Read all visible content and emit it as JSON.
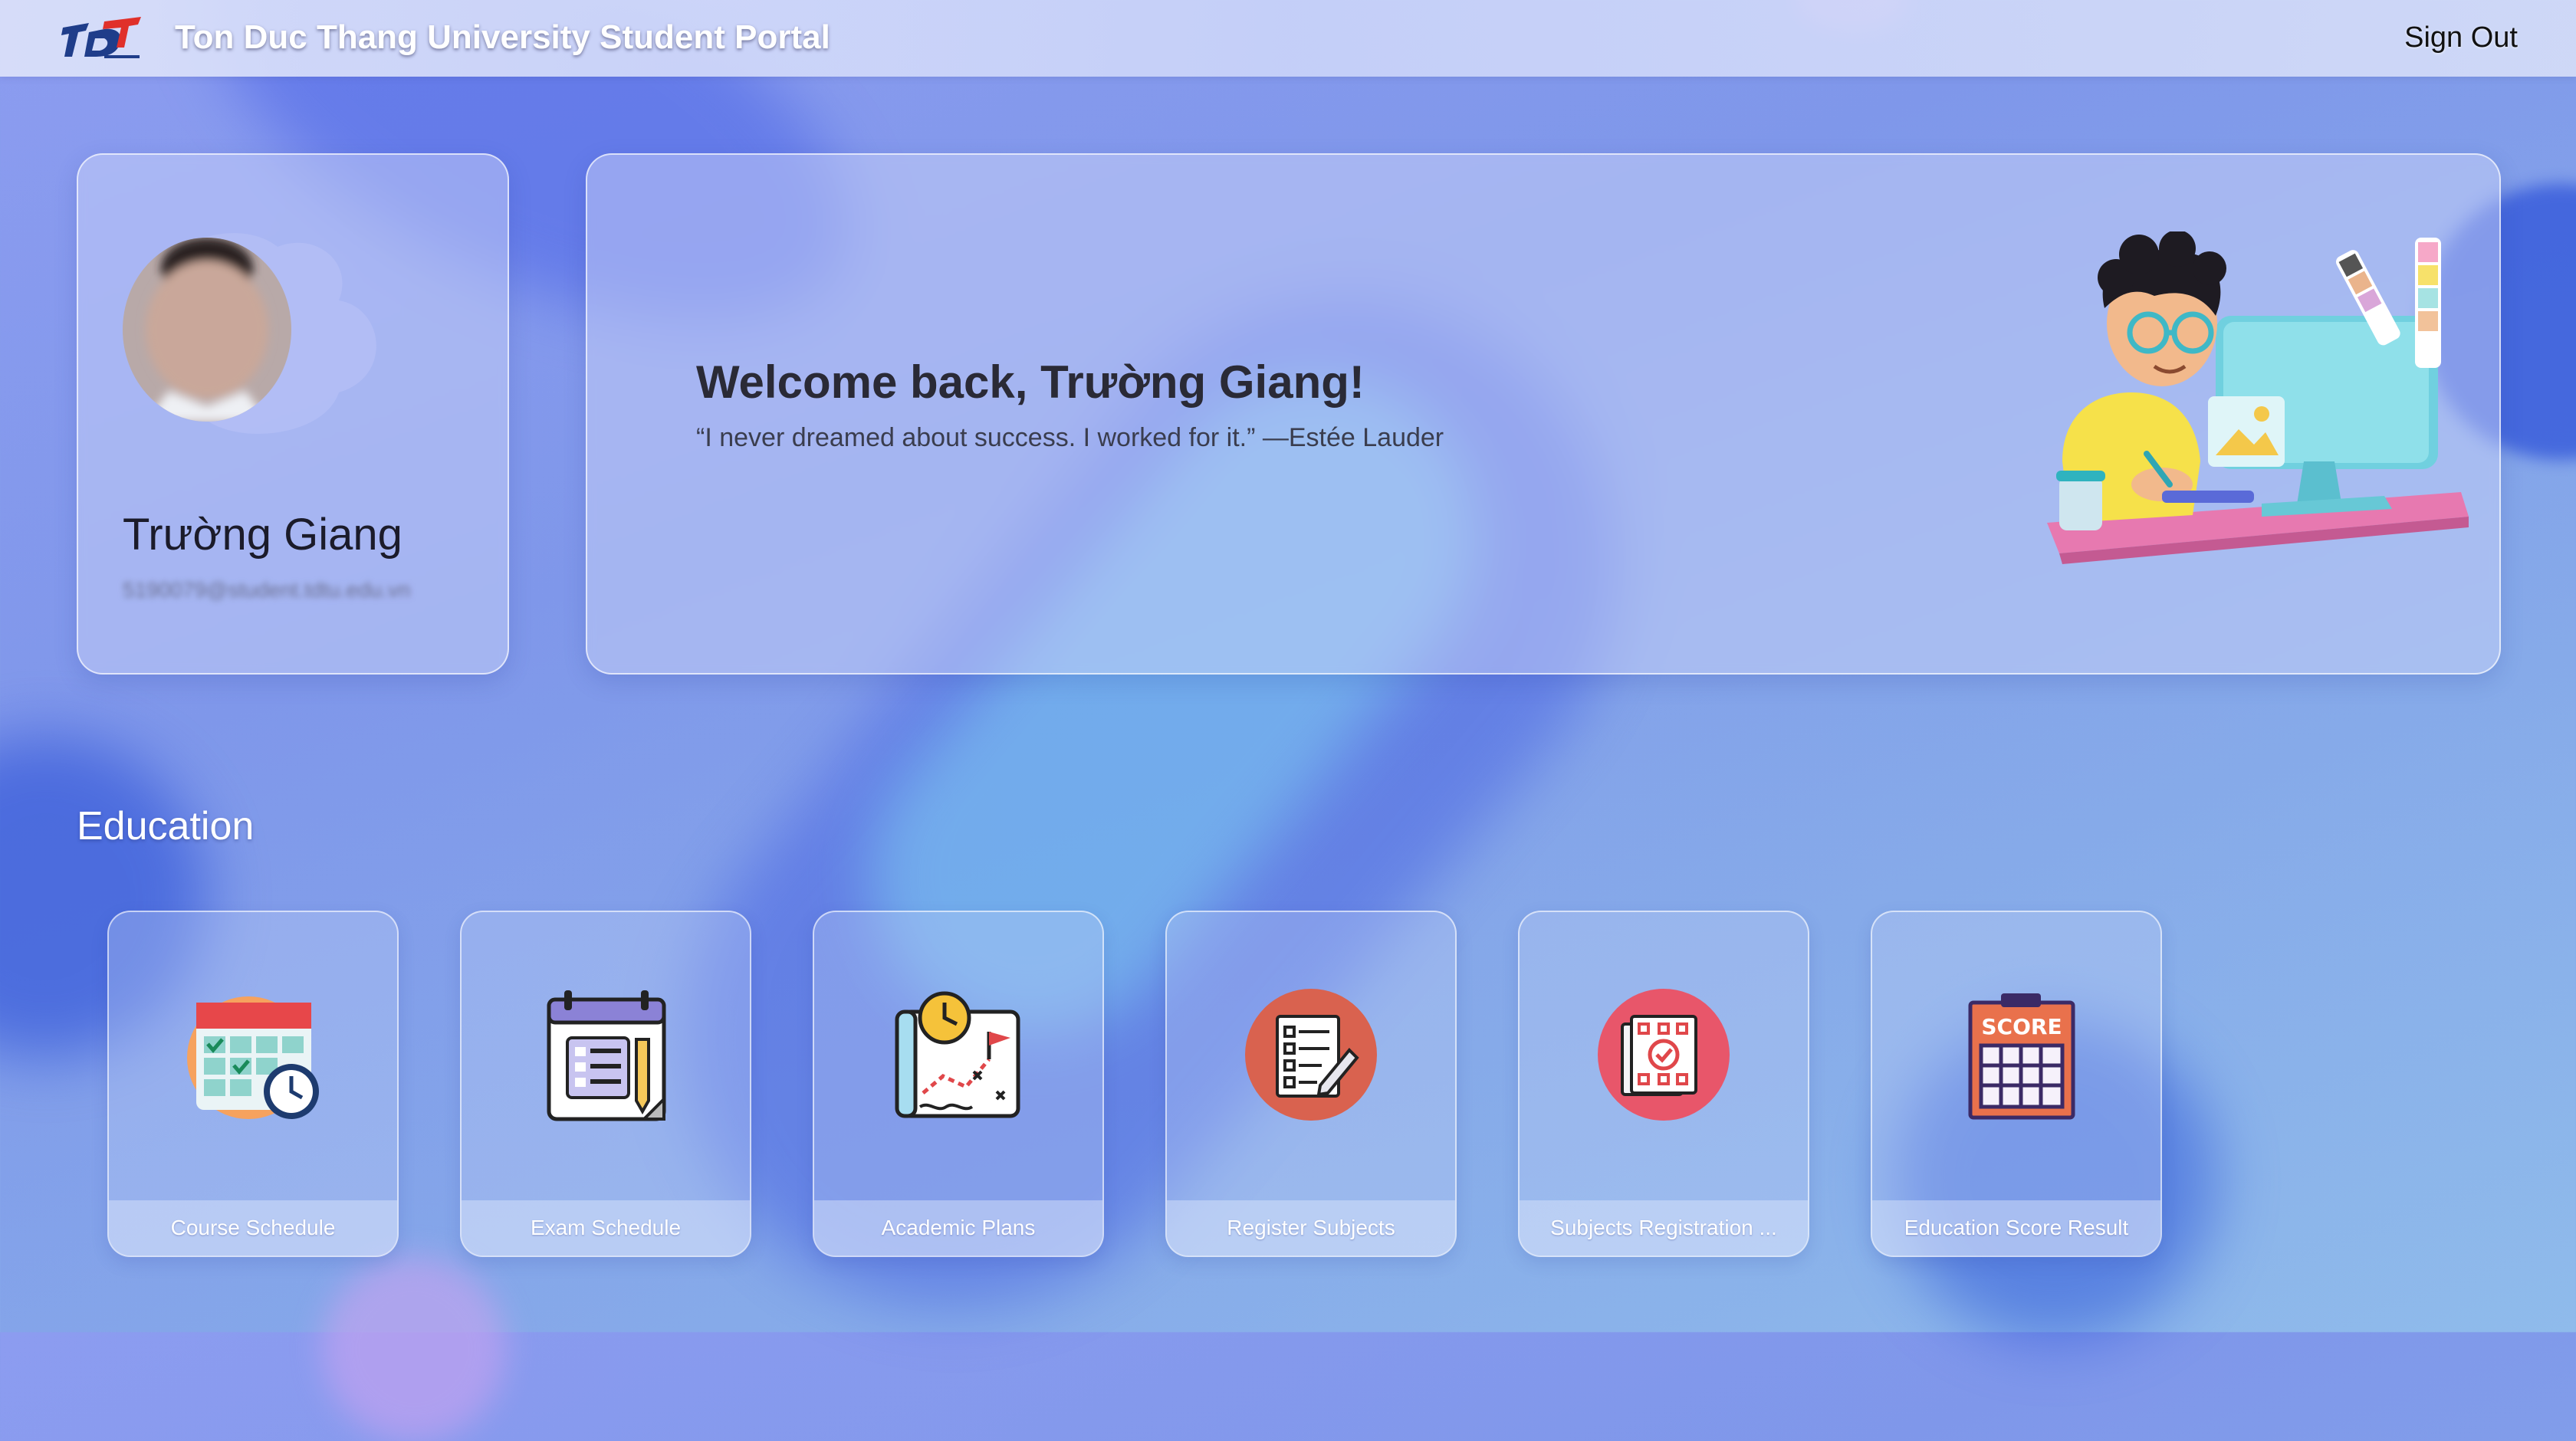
{
  "header": {
    "title": "Ton Duc Thang University Student Portal",
    "sign_out": "Sign Out",
    "logo_icon": "tdt-logo-icon"
  },
  "profile": {
    "name": "Trường Giang",
    "email": "5190079@student.tdtu.edu.vn"
  },
  "welcome": {
    "title": "Welcome back, Trường Giang!",
    "quote": "“I never dreamed about success. I worked for it.” —Estée Lauder"
  },
  "education": {
    "title": "Education",
    "tiles": [
      {
        "label": "Course Schedule",
        "icon": "calendar-clock-icon"
      },
      {
        "label": "Exam Schedule",
        "icon": "exam-calendar-icon"
      },
      {
        "label": "Academic Plans",
        "icon": "plan-map-icon"
      },
      {
        "label": "Register Subjects",
        "icon": "register-checklist-icon"
      },
      {
        "label": "Subjects Registration ...",
        "icon": "registration-result-icon"
      },
      {
        "label": "Education Score Result",
        "icon": "score-board-icon"
      }
    ]
  },
  "colors": {
    "accent_red": "#d9624f",
    "accent_pink": "#e8566a",
    "score_orange": "#e9714c"
  }
}
